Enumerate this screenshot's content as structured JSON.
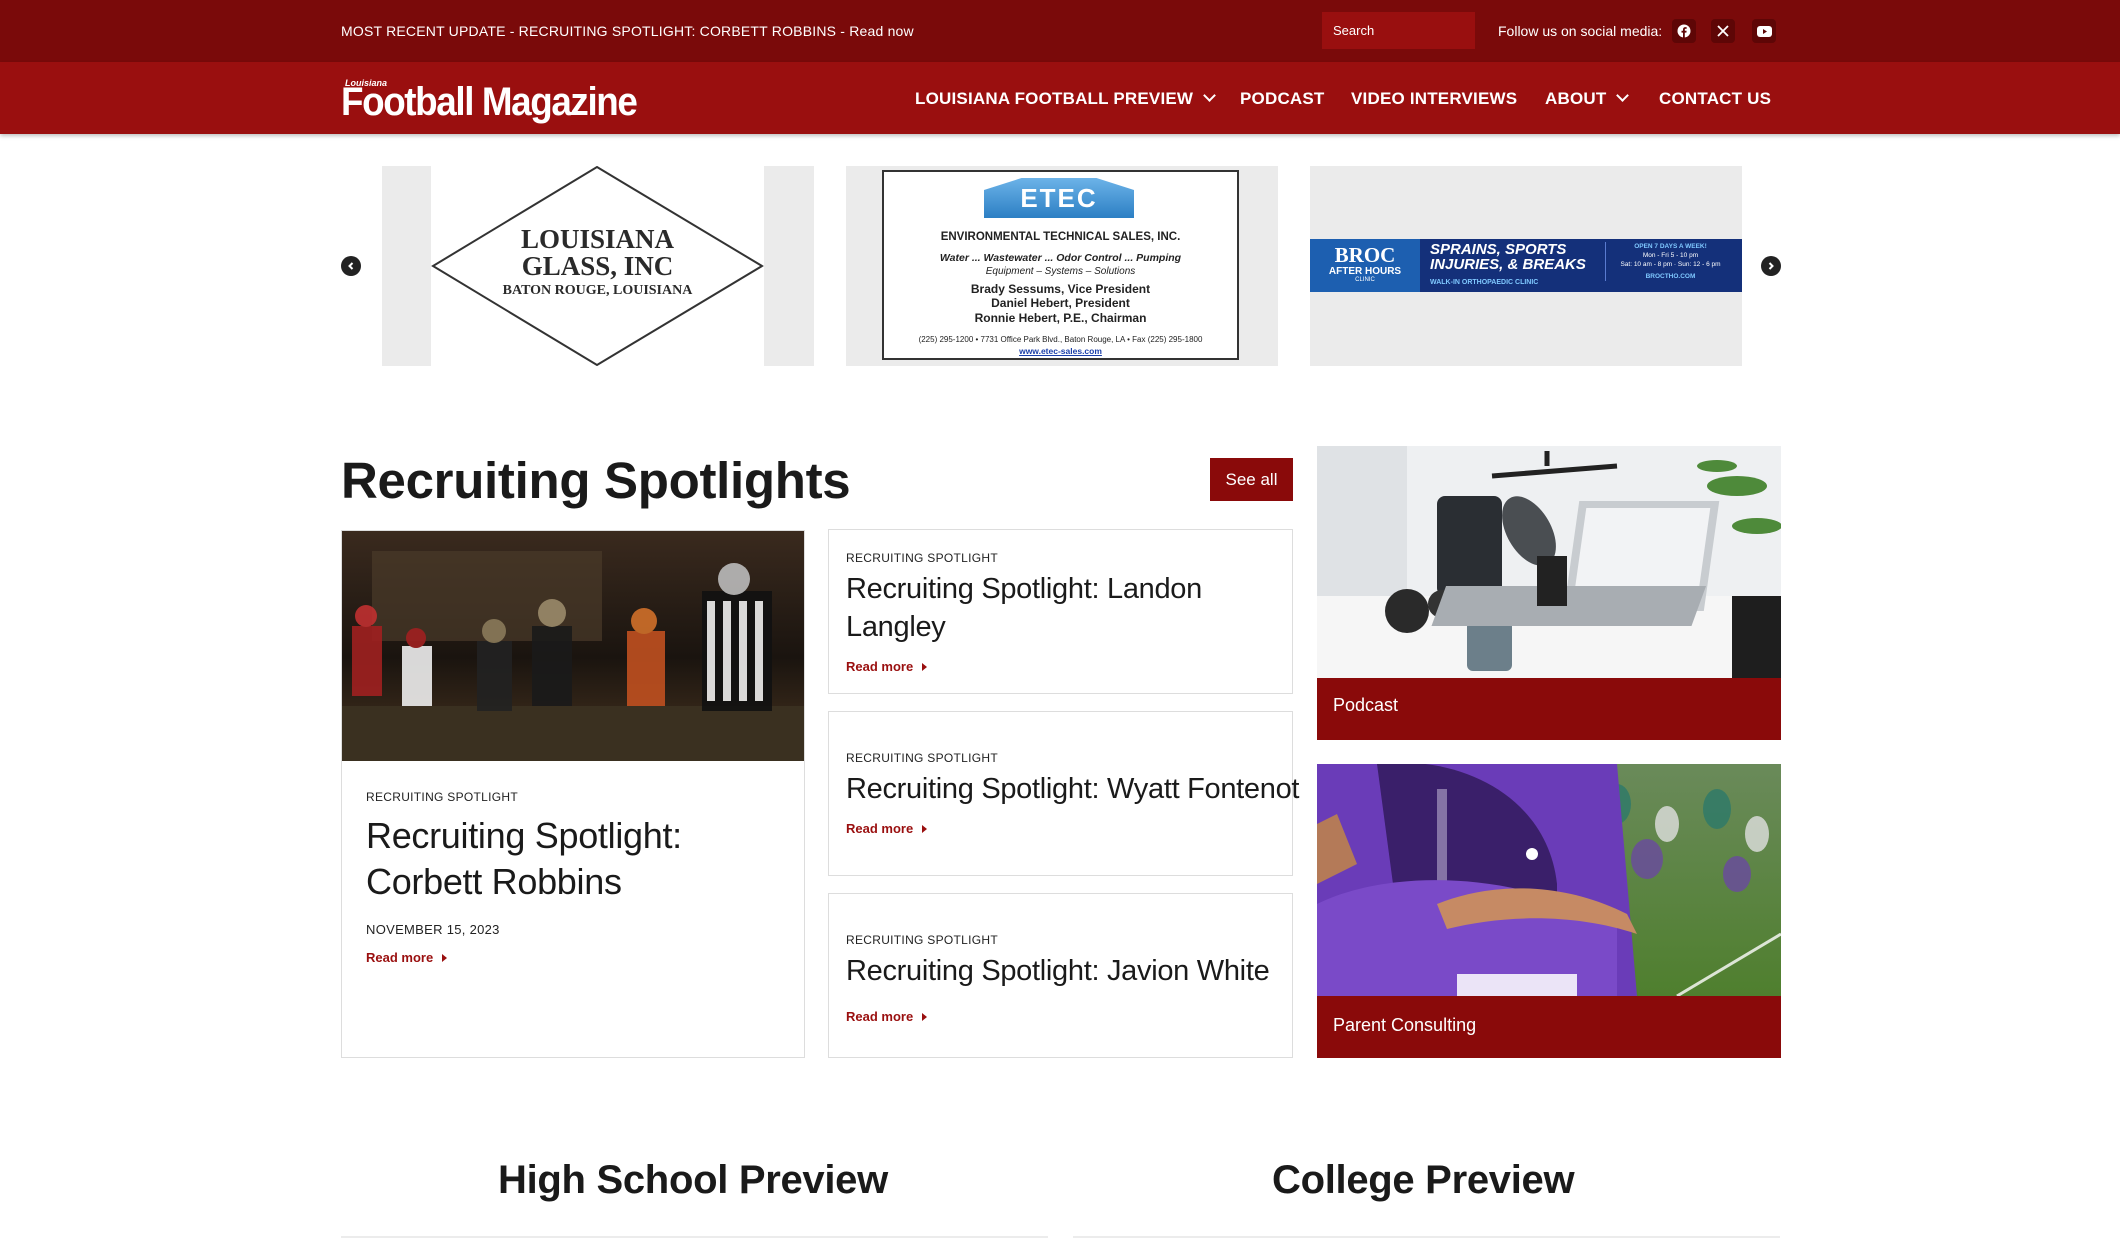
{
  "topbar": {
    "update_text": "MOST RECENT UPDATE - RECRUITING SPOTLIGHT: CORBETT ROBBINS - Read now",
    "search_placeholder": "Search",
    "follow_text": "Follow us on social media:",
    "social_icons": [
      "facebook-icon",
      "x-icon",
      "youtube-icon"
    ]
  },
  "logo": {
    "small": "Louisiana",
    "big": "Football Magazine"
  },
  "nav": {
    "items": [
      {
        "label": "LOUISIANA FOOTBALL PREVIEW",
        "dropdown": true
      },
      {
        "label": "PODCAST",
        "dropdown": false
      },
      {
        "label": "VIDEO INTERVIEWS",
        "dropdown": false
      },
      {
        "label": "ABOUT",
        "dropdown": true
      },
      {
        "label": "CONTACT US",
        "dropdown": false
      }
    ]
  },
  "sponsors": {
    "glass": {
      "line1": "LOUISIANA",
      "line2": "GLASS, INC",
      "line3": "BATON ROUGE, LOUISIANA"
    },
    "etec": {
      "logo": "ETEC",
      "name": "ENVIRONMENTAL TECHNICAL SALES, INC.",
      "services": "Water ... Wastewater ... Odor Control ... Pumping",
      "sub": "Equipment – Systems – Solutions",
      "p1": "Brady Sessums, Vice President",
      "p2": "Daniel Hebert, President",
      "p3": "Ronnie Hebert, P.E., Chairman",
      "contact": "(225) 295-1200 • 7731 Office Park Blvd., Baton Rouge, LA • Fax (225) 295-1800",
      "url": "www.etec-sales.com"
    },
    "broc": {
      "logo": "BROC",
      "sub": "AFTER HOURS",
      "clinic": "CLINIC",
      "headline1": "SPRAINS, SPORTS",
      "headline2": "INJURIES, & BREAKS",
      "walkin": "WALK-IN ORTHOPAEDIC CLINIC",
      "open": "OPEN 7 DAYS A WEEK!",
      "hours1": "Mon - Fri 5 - 10 pm",
      "hours2": "Sat: 10 am - 8 pm · Sun: 12 - 6 pm",
      "url": "BROCTHO.COM"
    }
  },
  "recruiting": {
    "heading": "Recruiting Spotlights",
    "see_all": "See all",
    "featured": {
      "category": "RECRUITING SPOTLIGHT",
      "title": "Recruiting Spotlight: Corbett Robbins",
      "date": "NOVEMBER 15, 2023",
      "read_more": "Read more"
    },
    "list": [
      {
        "category": "RECRUITING SPOTLIGHT",
        "title": "Recruiting Spotlight: Landon Langley",
        "read_more": "Read more"
      },
      {
        "category": "RECRUITING SPOTLIGHT",
        "title": "Recruiting Spotlight: Wyatt Fontenot",
        "read_more": "Read more"
      },
      {
        "category": "RECRUITING SPOTLIGHT",
        "title": "Recruiting Spotlight: Javion White",
        "read_more": "Read more"
      }
    ]
  },
  "sidebar": {
    "podcast": "Podcast",
    "parent": "Parent Consulting"
  },
  "previews": {
    "high_school": "High School Preview",
    "college": "College Preview"
  },
  "colors": {
    "primary": "#9a0f0f",
    "topbar": "#7a0a0a",
    "accent": "#8a0a0a"
  }
}
